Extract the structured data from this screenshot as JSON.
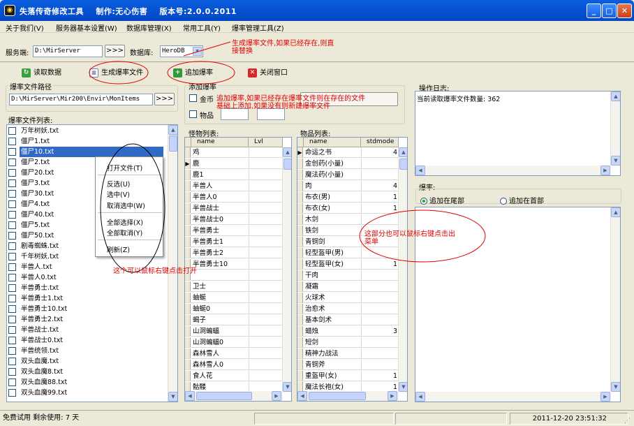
{
  "window": {
    "title": "失落传奇修改工具    制作:无心伤害    版本号:2.0.0.2011",
    "app_icon": "app-logo-icon",
    "minimize_label": "_",
    "maximize_label": "□",
    "close_label": "✕"
  },
  "menu": [
    "关于我们(V)",
    "服务器基本设置(W)",
    "数据库管理(X)",
    "常用工具(Y)",
    "爆率管理工具(Z)"
  ],
  "server_row": {
    "server_label": "服务端:",
    "server_path": "D:\\MirServer",
    "browse_label": ">>>",
    "db_label": "数据库:",
    "db_value": "HeroDB"
  },
  "toolbar": [
    {
      "label": "读取数据",
      "icon": "refresh-icon"
    },
    {
      "label": "生成爆率文件",
      "icon": "document-icon"
    },
    {
      "label": "追加爆率",
      "icon": "add-icon"
    },
    {
      "label": "关闭窗口",
      "icon": "close-window-icon"
    }
  ],
  "path_group": {
    "label": "爆率文件路径",
    "path": "D:\\MirServer\\Mir200\\Envir\\MonItems",
    "browse_label": ">>>"
  },
  "add_group": {
    "label": "添加爆率",
    "gold_label": "金币",
    "item_label": "物品"
  },
  "file_list": {
    "label": "爆率文件列表:",
    "selected_index": 2,
    "items": [
      "万年树妖.txt",
      "僵尸1.txt",
      "僵尸10.txt",
      "僵尸2.txt",
      "僵尸20.txt",
      "僵尸3.txt",
      "僵尸30.txt",
      "僵尸4.txt",
      "僵尸40.txt",
      "僵尸5.txt",
      "僵尸50.txt",
      "剧毒蜘蛛.txt",
      "千年树妖.txt",
      "半兽人.txt",
      "半兽人0.txt",
      "半兽勇士.txt",
      "半兽勇士1.txt",
      "半兽勇士10.txt",
      "半兽勇士2.txt",
      "半兽战士.txt",
      "半兽战士0.txt",
      "半兽统领.txt",
      "双头血魔.txt",
      "双头血魔8.txt",
      "双头血魔88.txt",
      "双头血魔99.txt"
    ]
  },
  "context_menu": [
    "打开文件(T)",
    "反选(U)",
    "选中(V)",
    "取消选中(W)",
    "全部选择(X)",
    "全部取消(Y)",
    "刷新(Z)"
  ],
  "monster_list": {
    "label": "怪物列表:",
    "headers": [
      "name",
      "Lvl"
    ],
    "rows": [
      {
        "name": "鸡",
        "val": ""
      },
      {
        "name": "鹿",
        "val": ""
      },
      {
        "name": "鹿1",
        "val": ""
      },
      {
        "name": "半兽人",
        "val": ""
      },
      {
        "name": "半兽人0",
        "val": ""
      },
      {
        "name": "半兽战士",
        "val": ""
      },
      {
        "name": "半兽战士0",
        "val": ""
      },
      {
        "name": "半兽勇士",
        "val": ""
      },
      {
        "name": "半兽勇士1",
        "val": ""
      },
      {
        "name": "半兽勇士2",
        "val": ""
      },
      {
        "name": "半兽勇士10",
        "val": ""
      },
      {
        "name": "",
        "val": ""
      },
      {
        "name": "卫士",
        "val": ""
      },
      {
        "name": "蚰蜒",
        "val": ""
      },
      {
        "name": "蚰蜒0",
        "val": ""
      },
      {
        "name": "蝎子",
        "val": ""
      },
      {
        "name": "山洞蝙蝠",
        "val": ""
      },
      {
        "name": "山洞蝙蝠0",
        "val": ""
      },
      {
        "name": "森林雪人",
        "val": ""
      },
      {
        "name": "森林雪人0",
        "val": ""
      },
      {
        "name": "食人花",
        "val": ""
      },
      {
        "name": "骷髅",
        "val": ""
      }
    ]
  },
  "item_list": {
    "label": "物品列表:",
    "headers": [
      "name",
      "stdmode"
    ],
    "rows": [
      {
        "name": "命运之书",
        "val": "4"
      },
      {
        "name": "金创药(小量)",
        "val": ""
      },
      {
        "name": "魔法药(小量)",
        "val": ""
      },
      {
        "name": "肉",
        "val": "4"
      },
      {
        "name": "布衣(男)",
        "val": "1"
      },
      {
        "name": "布衣(女)",
        "val": "1"
      },
      {
        "name": "木剑",
        "val": ""
      },
      {
        "name": "铁剑",
        "val": ""
      },
      {
        "name": "青铜剑",
        "val": ""
      },
      {
        "name": "轻型盔甲(男)",
        "val": ""
      },
      {
        "name": "轻型盔甲(女)",
        "val": "1"
      },
      {
        "name": "干肉",
        "val": ""
      },
      {
        "name": "凝霜",
        "val": ""
      },
      {
        "name": "火球术",
        "val": ""
      },
      {
        "name": "治愈术",
        "val": ""
      },
      {
        "name": "基本剑术",
        "val": ""
      },
      {
        "name": "蜡烛",
        "val": "3"
      },
      {
        "name": "短剑",
        "val": ""
      },
      {
        "name": "精神力战法",
        "val": ""
      },
      {
        "name": "青铜斧",
        "val": ""
      },
      {
        "name": "重盔甲(女)",
        "val": "1"
      },
      {
        "name": "魔法长袍(女)",
        "val": "1"
      }
    ]
  },
  "log": {
    "label": "操作日志:",
    "text": "当前读取爆率文件数量: 362"
  },
  "rate": {
    "label": "爆率:",
    "opt_tail": "追加在尾部",
    "opt_head": "追加在首部"
  },
  "annotations": {
    "gen_note": "生成爆率文件,如果已经存在,则直\n接替换",
    "add_note": "追加爆率,如果已经存在爆率文件则在存在的文件\n基础上添加,如果没有则新建爆率文件",
    "right_note": "这部分也可以鼠标右键点击出\n菜单",
    "list_note": "这个可以鼠标右键点击打开",
    "color": "#e00000"
  },
  "status": {
    "trial": "免费试用 剩余使用: 7 天",
    "datetime": "2011-12-20  23:51:32"
  }
}
